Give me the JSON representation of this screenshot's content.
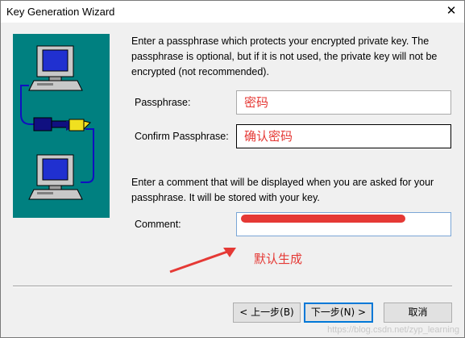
{
  "window": {
    "title": "Key Generation Wizard",
    "close_label": "✕"
  },
  "content": {
    "intro_text": "Enter a passphrase which protects your encrypted private key.  The passphrase is optional, but if it is not used, the private key will not be encrypted (not recommended).",
    "passphrase_label": "Passphrase:",
    "passphrase_value": "密码",
    "confirm_label": "Confirm Passphrase:",
    "confirm_value": "确认密码",
    "comment_intro": "Enter a comment that will be displayed when you are asked for your passphrase. It will be stored with your key.",
    "comment_label": "Comment:"
  },
  "annotation": {
    "text": "默认生成",
    "color": "#e53935"
  },
  "buttons": {
    "back": "< 上一步(B)",
    "next": "下一步(N) >",
    "cancel": "取消"
  },
  "watermark": "https://blog.csdn.net/zyp_learning",
  "colors": {
    "illustration_bg": "#008080",
    "annotation": "#e53935"
  }
}
